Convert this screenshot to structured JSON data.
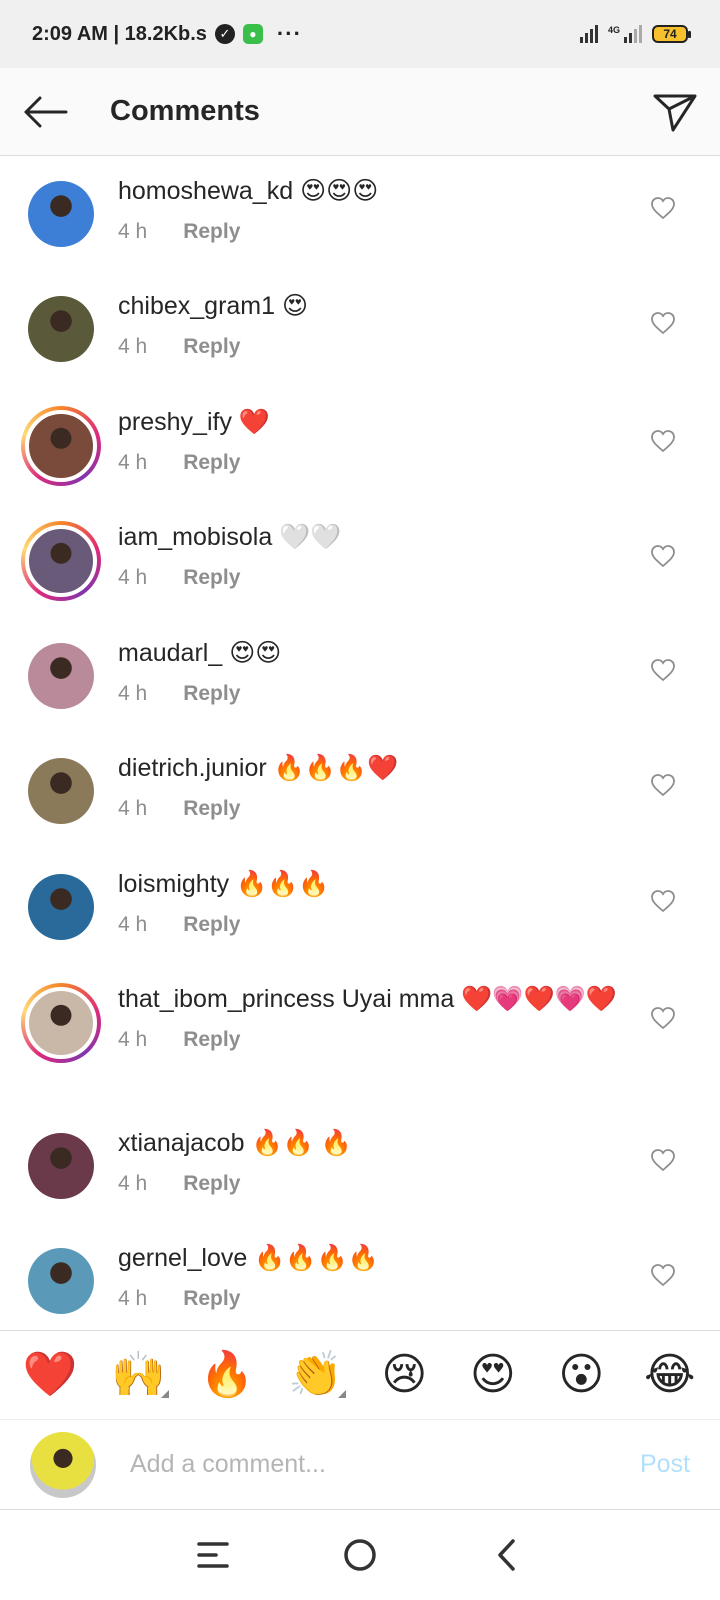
{
  "status_bar": {
    "time_speed": "2:09 AM | 18.2Kb.s",
    "dots": "···",
    "network_label": "4G",
    "battery": "74"
  },
  "header": {
    "title": "Comments"
  },
  "comments": [
    {
      "user": "homoshewa_kd",
      "text": "😍😍😍",
      "time": "4 h",
      "reply": "Reply",
      "story": false,
      "avatar_color": "#3d7fd6"
    },
    {
      "user": "chibex_gram1",
      "text": "😍",
      "time": "4 h",
      "reply": "Reply",
      "story": false,
      "avatar_color": "#5a5a3a"
    },
    {
      "user": "preshy_ify",
      "text": "❤️",
      "time": "4 h",
      "reply": "Reply",
      "story": true,
      "avatar_color": "#7a4a3a"
    },
    {
      "user": "iam_mobisola",
      "text": "🤍🤍",
      "time": "4 h",
      "reply": "Reply",
      "story": true,
      "avatar_color": "#6a5a7a"
    },
    {
      "user": "maudarl_",
      "text": "😍😍",
      "time": "4 h",
      "reply": "Reply",
      "story": false,
      "avatar_color": "#b88a9a"
    },
    {
      "user": "dietrich.junior",
      "text": "🔥🔥🔥❤️",
      "time": "4 h",
      "reply": "Reply",
      "story": false,
      "avatar_color": "#8a7a5a"
    },
    {
      "user": "loismighty",
      "text": "🔥🔥🔥",
      "time": "4 h",
      "reply": "Reply",
      "story": false,
      "avatar_color": "#2a6a9a"
    },
    {
      "user": "that_ibom_princess",
      "text": "Uyai mma ❤️💗❤️💗❤️",
      "time": "4 h",
      "reply": "Reply",
      "story": true,
      "avatar_color": "#c9b8a8"
    },
    {
      "user": "xtianajacob",
      "text": "🔥🔥 🔥",
      "time": "4 h",
      "reply": "Reply",
      "story": false,
      "avatar_color": "#6a3a4a"
    },
    {
      "user": "gernel_love",
      "text": "🔥🔥🔥🔥",
      "time": "4 h",
      "reply": "Reply",
      "story": false,
      "avatar_color": "#5a9ab8"
    }
  ],
  "emoji_bar": [
    "❤️",
    "🙌",
    "🔥",
    "👏",
    "😢",
    "😍",
    "😮",
    "😂"
  ],
  "composer": {
    "placeholder": "Add a comment...",
    "post_label": "Post"
  }
}
